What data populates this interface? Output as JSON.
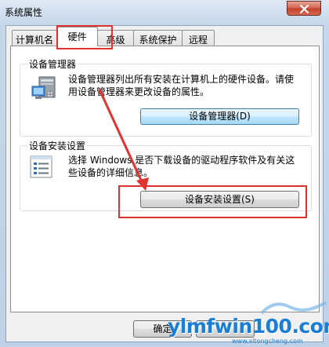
{
  "window": {
    "title": "系统属性"
  },
  "tabs": [
    {
      "label": "计算机名"
    },
    {
      "label": "硬件"
    },
    {
      "label": "高级"
    },
    {
      "label": "系统保护"
    },
    {
      "label": "远程"
    }
  ],
  "device_manager": {
    "heading": "设备管理器",
    "description_line1": "设备管理器列出所有安装在计算机上的硬件设备。请使",
    "description_line2": "用设备管理器来更改设备的属性。",
    "button_label": "设备管理器(D)"
  },
  "device_installation": {
    "heading": "设备安装设置",
    "description_line1": "选择 Windows 是否下载设备的驱动程序软件及有关这",
    "description_line2": "些设备的详细信息。",
    "button_label": "设备安装设置(S)"
  },
  "footer": {
    "ok_label": "确定"
  },
  "watermark": {
    "text": "ylmfwin100.com",
    "subtext": "www.xitongcheng.com"
  },
  "colors": {
    "annotation": "#e0322f",
    "watermark": "#1a7fd4"
  }
}
